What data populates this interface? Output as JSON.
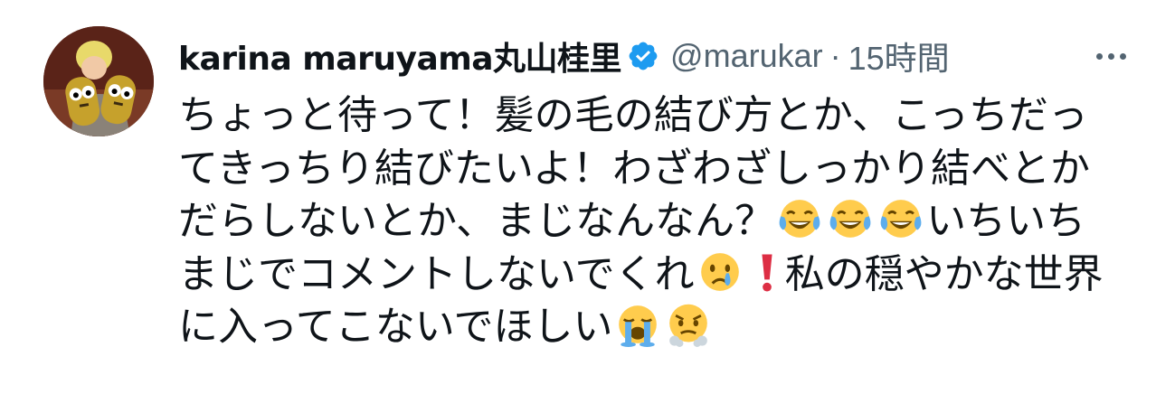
{
  "tweet": {
    "author": {
      "display_name": "karina maruyama丸山桂里",
      "verified": true,
      "handle": "@marukar",
      "separator": "·",
      "timestamp": "15時間"
    },
    "more_menu": "more-options-icon",
    "text_lines": {
      "l1": "ちょっと待って！髪の毛の結び方とか、こっちだっ",
      "l2": "てきっちり結びたいよ！わざわざしっかり結べとか",
      "l3a": "だらしないとか、まじなんなん？",
      "l3b": "いちいち",
      "l4a": "まじでコメントしないでくれ",
      "l4b": "私の穏やかな世界",
      "l5a": "に入ってこないでほしい"
    },
    "emojis": [
      "face-with-tears-of-joy",
      "face-with-tears-of-joy",
      "face-with-tears-of-joy",
      "crying-face",
      "red-exclamation-mark",
      "loudly-crying-face",
      "face-with-steam-from-nose"
    ],
    "colors": {
      "verified": "#1d9bf0",
      "text": "#0f1419",
      "secondary": "#536471"
    }
  }
}
